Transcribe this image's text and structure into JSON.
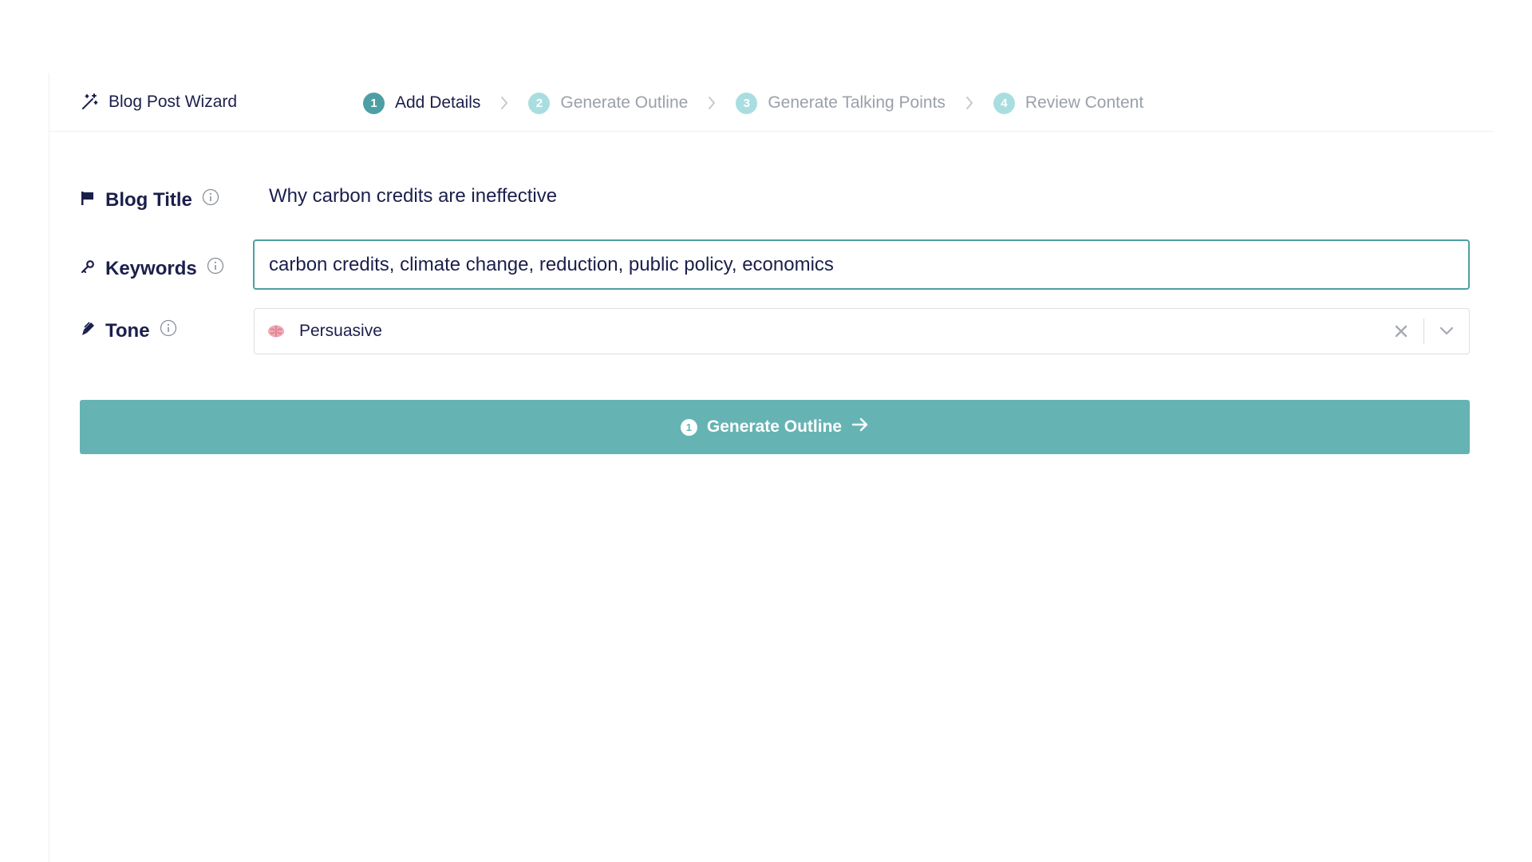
{
  "header": {
    "brand_title": "Blog Post Wizard",
    "steps": [
      {
        "number": "1",
        "label": "Add Details",
        "state": "active"
      },
      {
        "number": "2",
        "label": "Generate Outline",
        "state": "inactive"
      },
      {
        "number": "3",
        "label": "Generate Talking Points",
        "state": "inactive"
      },
      {
        "number": "4",
        "label": "Review Content",
        "state": "inactive"
      }
    ]
  },
  "form": {
    "blog_title": {
      "label": "Blog Title",
      "icon": "flag-icon",
      "value": "Why carbon credits are ineffective"
    },
    "keywords": {
      "label": "Keywords",
      "icon": "key-icon",
      "value": "carbon credits, climate change, reduction, public policy, economics"
    },
    "tone": {
      "label": "Tone",
      "icon": "pen-icon",
      "value": "Persuasive",
      "value_icon": "brain-icon"
    }
  },
  "actions": {
    "generate_step_number": "1",
    "generate_label": "Generate Outline"
  },
  "colors": {
    "accent": "#4e9fa3",
    "button": "#66b3b4",
    "step_inactive": "#a9dee1",
    "text": "#1b1f4b",
    "muted_text": "#9aa0aa"
  }
}
